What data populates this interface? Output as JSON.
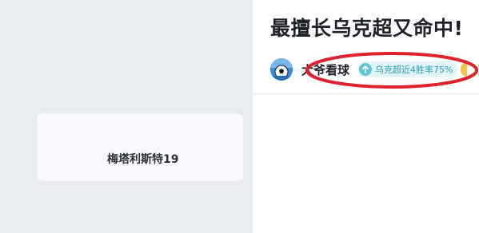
{
  "article": {
    "title": "最擅长乌克超又命中!",
    "author": "大爷看球",
    "badge_text": "乌克超近4胜率75%",
    "card_text": "梅塔利斯特19"
  },
  "icons": {
    "avatar": "soccer-ball-avatar",
    "badge": "arrow-up-icon"
  },
  "colors": {
    "left_panel": "#e8ebf0",
    "badge_bg": "#e2f5f7",
    "badge_text": "#2a9db0",
    "highlight": "#e0202a"
  }
}
